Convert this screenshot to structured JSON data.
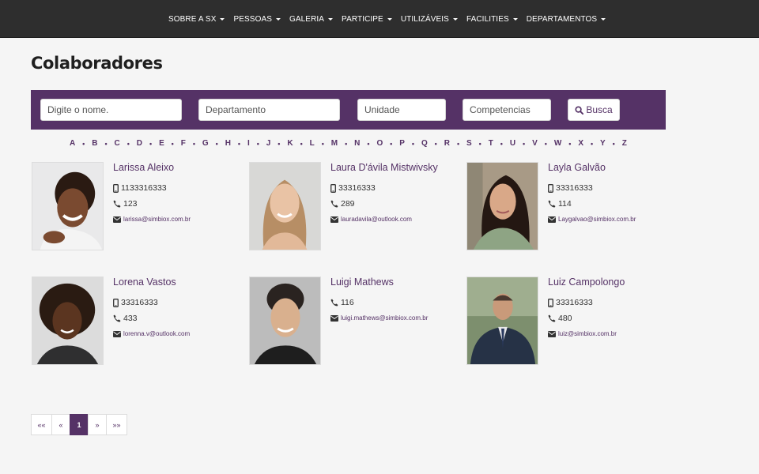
{
  "nav": {
    "items": [
      {
        "label": "SOBRE A SX"
      },
      {
        "label": "PESSOAS"
      },
      {
        "label": "GALERIA"
      },
      {
        "label": "PARTICIPE"
      },
      {
        "label": "UTILIZÁVEIS"
      },
      {
        "label": "FACILITIES"
      },
      {
        "label": "DEPARTAMENTOS"
      }
    ]
  },
  "page_title": "Colaboradores",
  "search": {
    "name_placeholder": "Digite o nome.",
    "department_placeholder": "Departamento",
    "unit_placeholder": "Unidade",
    "skills_placeholder": "Competencias",
    "button_label": "Busca",
    "accent_color": "#553266"
  },
  "alphabet": [
    "A",
    "B",
    "C",
    "D",
    "E",
    "F",
    "G",
    "H",
    "I",
    "J",
    "K",
    "L",
    "M",
    "N",
    "O",
    "P",
    "Q",
    "R",
    "S",
    "T",
    "U",
    "V",
    "W",
    "X",
    "Y",
    "Z"
  ],
  "people": [
    {
      "name": "Larissa Aleixo",
      "mobile": "1133316333",
      "phone": "123",
      "email": "larissa@simbiox.com.br"
    },
    {
      "name": "Laura D'ávila Mistwivsky",
      "mobile": "33316333",
      "phone": "289",
      "email": "lauradavila@outlook.com"
    },
    {
      "name": "Layla Galvão",
      "mobile": "33316333",
      "phone": "114",
      "email": "Laygalvao@simbiox.com.br"
    },
    {
      "name": "Lorena Vastos",
      "mobile": "33316333",
      "phone": "433",
      "email": "lorenna.v@outlook.com"
    },
    {
      "name": "Luigi Mathews",
      "mobile": "",
      "phone": "116",
      "email": "luigi.mathews@simbiox.com.br"
    },
    {
      "name": "Luiz Campolongo",
      "mobile": "33316333",
      "phone": "480",
      "email": "luiz@simbiox.com.br"
    }
  ],
  "pagination": {
    "first": "««",
    "prev": "«",
    "current": "1",
    "next": "»",
    "last": "»»"
  }
}
